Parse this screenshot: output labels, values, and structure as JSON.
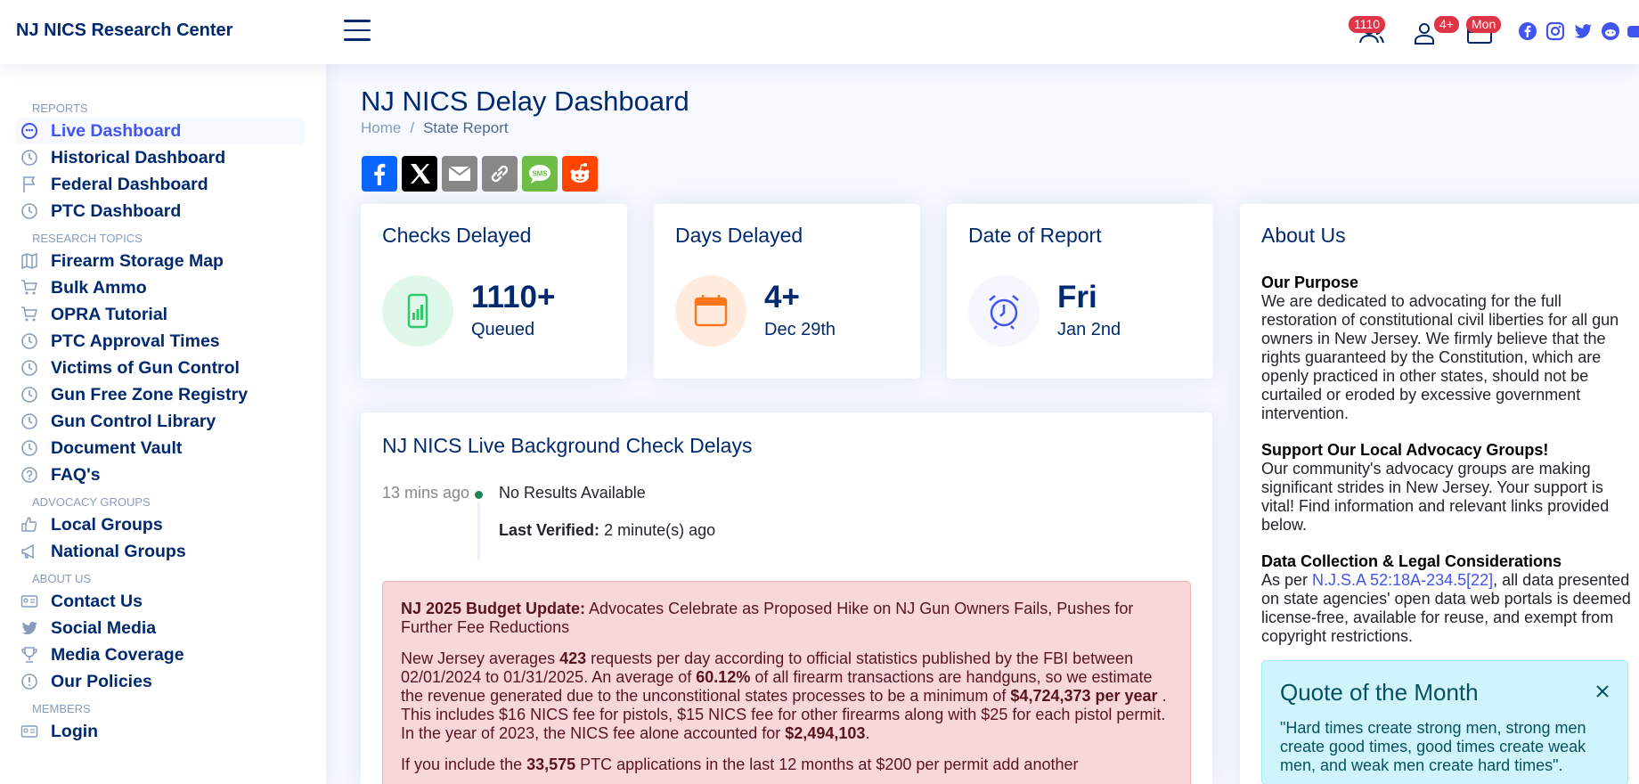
{
  "header": {
    "brand": "NJ NICS Research Center",
    "badges": {
      "queued": "1110",
      "days": "4+",
      "day": "Mon"
    }
  },
  "sidebar": {
    "sections": [
      {
        "heading": "REPORTS",
        "items": [
          "Live Dashboard",
          "Historical Dashboard",
          "Federal Dashboard",
          "PTC Dashboard"
        ]
      },
      {
        "heading": "RESEARCH TOPICS",
        "items": [
          "Firearm Storage Map",
          "Bulk Ammo",
          "OPRA Tutorial",
          "PTC Approval Times",
          "Victims of Gun Control",
          "Gun Free Zone Registry",
          "Gun Control Library",
          "Document Vault",
          "FAQ's"
        ]
      },
      {
        "heading": "ADVOCACY GROUPS",
        "items": [
          "Local Groups",
          "National Groups"
        ]
      },
      {
        "heading": "ABOUT US",
        "items": [
          "Contact Us",
          "Social Media",
          "Media Coverage",
          "Our Policies"
        ]
      },
      {
        "heading": "MEMBERS",
        "items": [
          "Login"
        ]
      }
    ]
  },
  "main": {
    "title": "NJ NICS Delay Dashboard",
    "breadcrumb": {
      "home": "Home",
      "sep": "/",
      "current": "State Report"
    },
    "cards": {
      "checks": {
        "title": "Checks Delayed",
        "value": "1110+",
        "sub": "Queued"
      },
      "days": {
        "title": "Days Delayed",
        "value": "4+",
        "sub": "Dec 29th"
      },
      "date": {
        "title": "Date of Report",
        "value": "Fri",
        "sub": "Jan 2nd"
      }
    },
    "live": {
      "title": "NJ NICS Live Background Check Delays",
      "time": "13 mins ago",
      "status": "No Results Available",
      "verified_label": "Last Verified:",
      "verified_value": "2 minute(s) ago"
    },
    "alert": {
      "headline_bold": "NJ 2025 Budget Update:",
      "headline_rest": " Advocates Celebrate as Proposed Hike on NJ Gun Owners Fails, Pushes for Further Fee Reductions",
      "p2_a": "New Jersey averages ",
      "p2_b": "423",
      "p2_c": " requests per day according to official statistics published by the FBI between 02/01/2024 to 01/31/2025. An average of ",
      "p2_d": "60.12%",
      "p2_e": " of all firearm transactions are handguns, so we estimate the revenue generated due to the unconstitional states processes to be a minimum of ",
      "p2_f": "$4,724,373 per year",
      "p2_g": " . This includes $16 NICS fee for pistols, $15 NICS fee for other firearms along with $25 for each pistol permit. In the year of 2023, the NICS fee alone accounted for ",
      "p2_h": "$2,494,103",
      "p2_i": ".",
      "p3_a": "If you include the ",
      "p3_b": "33,575",
      "p3_c": " PTC applications in the last 12 months at $200 per permit add another"
    },
    "about": {
      "title": "About Us",
      "purpose_h": "Our Purpose",
      "purpose_p": "We are dedicated to advocating for the full restoration of constitutional civil liberties for all gun owners in New Jersey. We firmly believe that the rights guaranteed by the Constitution, which are openly practiced in other states, should not be curtailed or eroded by excessive government intervention.",
      "support_h": "Support Our Local Advocacy Groups!",
      "support_p": "Our community's advocacy groups are making significant strides in New Jersey. Your support is vital! Find information and relevant links provided below.",
      "data_h": "Data Collection & Legal Considerations",
      "data_p1": "As per ",
      "data_link": "N.J.S.A 52:18A-234.5[22]",
      "data_p2": ", all data presented on state agencies' open data web portals is deemed license-free, available for reuse, and exempt from copyright restrictions."
    },
    "quote": {
      "title": "Quote of the Month",
      "text": "\"Hard times create strong men, strong men create good times, good times create weak men, and weak men create hard times\"."
    }
  },
  "colors": {
    "primary": "#012970",
    "accent": "#4154f1",
    "success": "#198754",
    "danger": "#dc3545"
  }
}
